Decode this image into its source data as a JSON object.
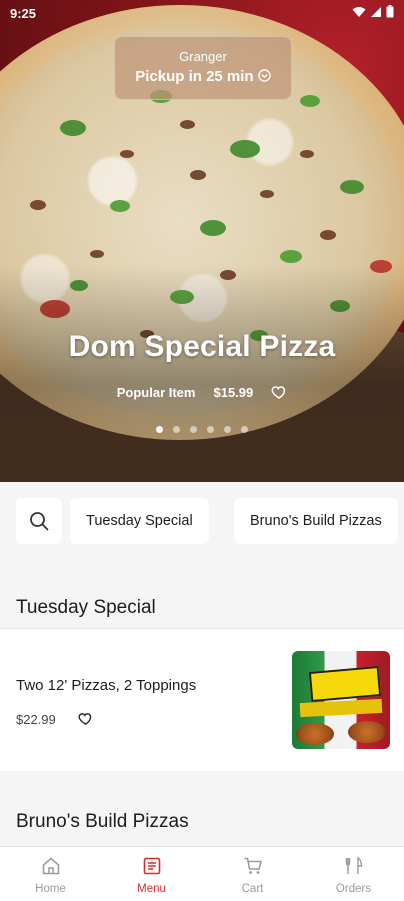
{
  "status_bar": {
    "time": "9:25"
  },
  "hero": {
    "pickup_location": "Granger",
    "pickup_time": "Pickup in 25 min",
    "title": "Dom Special Pizza",
    "tag": "Popular Item",
    "price": "$15.99",
    "slides": 6,
    "active_slide": 0
  },
  "categories": {
    "items": [
      "Tuesday Special",
      "Bruno's Build Pizzas"
    ]
  },
  "sections": [
    {
      "title": "Tuesday Special",
      "items": [
        {
          "name": "Two 12' Pizzas, 2 Toppings",
          "price": "$22.99"
        }
      ]
    },
    {
      "title": "Bruno's Build Pizzas"
    }
  ],
  "bottom_nav": {
    "tabs": [
      {
        "label": "Home",
        "icon": "home-icon"
      },
      {
        "label": "Menu",
        "icon": "menu-icon"
      },
      {
        "label": "Cart",
        "icon": "cart-icon"
      },
      {
        "label": "Orders",
        "icon": "orders-icon"
      }
    ],
    "active": "Menu"
  },
  "colors": {
    "accent": "#d32f2f",
    "background": "#f5f5f5"
  }
}
